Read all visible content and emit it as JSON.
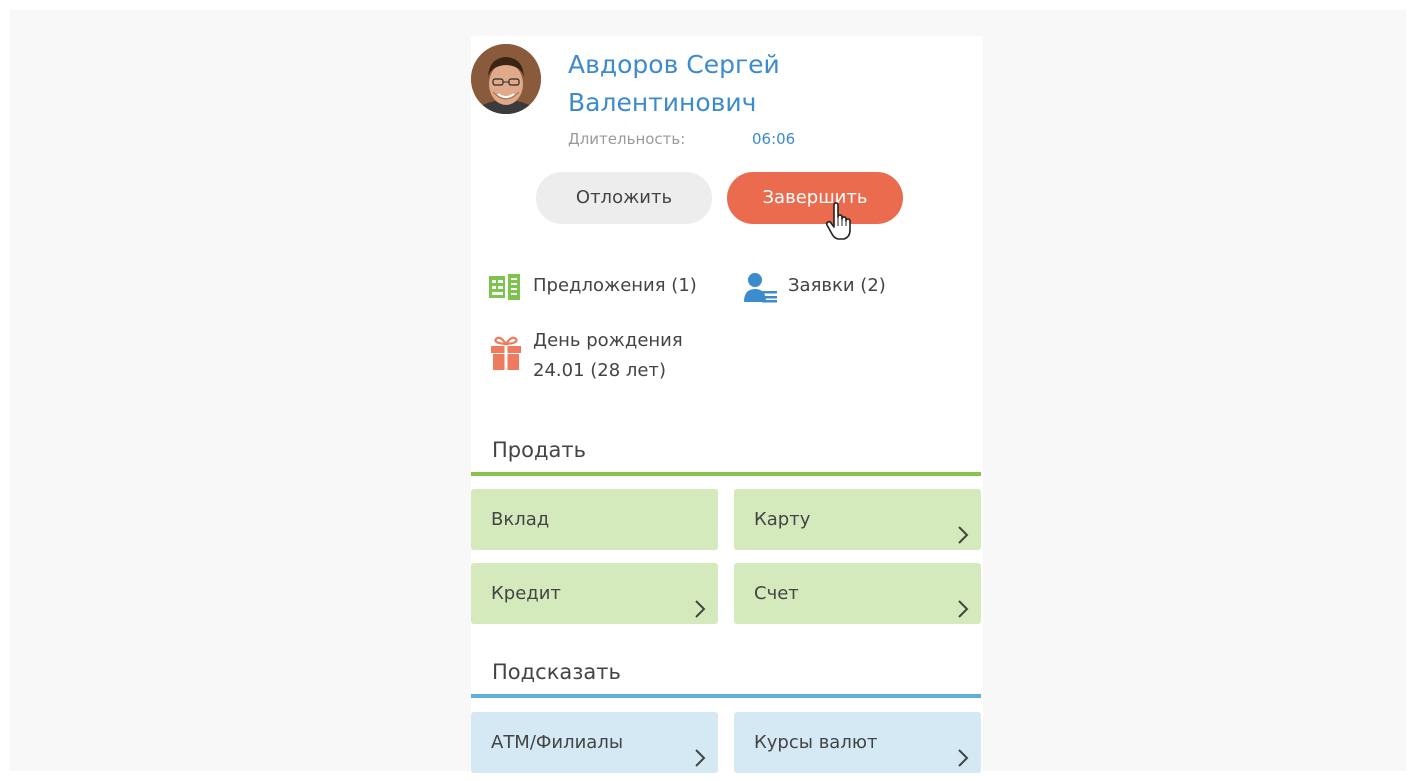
{
  "contact": {
    "name": "Авдоров Сергей Валентинович",
    "duration_label": "Длительность:",
    "duration_value": "06:06"
  },
  "actions": {
    "postpone_label": "Отложить",
    "finish_label": "Завершить"
  },
  "info": {
    "offers_label": "Предложения (1)",
    "requests_label": "Заявки (2)",
    "birthday_title": "День рождения",
    "birthday_value": "24.01 (28 лет)"
  },
  "sections": {
    "sell": {
      "title": "Продать",
      "color": "#8bc34a",
      "tiles": [
        {
          "label": "Вклад",
          "chevron": false
        },
        {
          "label": "Карту",
          "chevron": true
        },
        {
          "label": "Кредит",
          "chevron": true
        },
        {
          "label": "Счет",
          "chevron": true
        }
      ]
    },
    "hint": {
      "title": "Подсказать",
      "color": "#5fb0d8",
      "tiles": [
        {
          "label": "АТМ/Филиалы",
          "chevron": true
        },
        {
          "label": "Курсы валют",
          "chevron": true
        }
      ]
    }
  },
  "colors": {
    "accent_blue": "#3c8bcd",
    "finish_red": "#eb6b4f",
    "tile_green": "#d4eabd",
    "tile_blue": "#d4e9f4"
  },
  "icons": {
    "offers": "offers-document-icon",
    "requests": "user-list-icon",
    "birthday": "gift-icon",
    "chevron": "chevron-right-icon"
  }
}
